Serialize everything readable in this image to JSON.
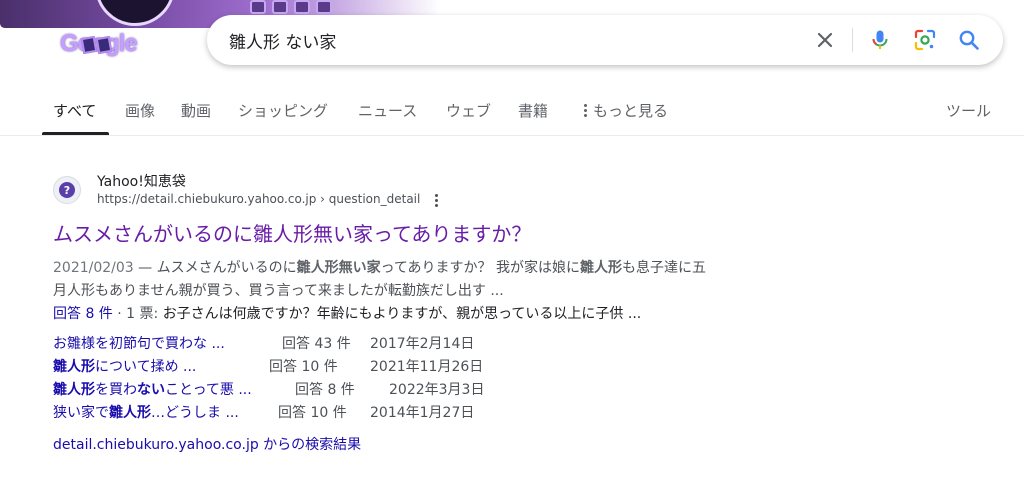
{
  "header": {
    "logo_text": "Google"
  },
  "search": {
    "query": "雛人形 ない家"
  },
  "tabs": [
    {
      "label": "すべて",
      "active": true
    },
    {
      "label": "画像"
    },
    {
      "label": "動画"
    },
    {
      "label": "ショッピング"
    },
    {
      "label": "ニュース"
    },
    {
      "label": "ウェブ"
    },
    {
      "label": "書籍"
    },
    {
      "label": "もっと見る"
    }
  ],
  "tools_label": "ツール",
  "result": {
    "site_name": "Yahoo!知恵袋",
    "url": "https://detail.chiebukuro.yahoo.co.jp › question_detail",
    "title": "ムスメさんがいるのに雛人形無い家ってありますか？",
    "snippet": {
      "date": "2021/02/03",
      "sep": " — ",
      "part1": "ムスメさんがいるのに",
      "bold1": "雛人形無い家",
      "part2": "ってありますか？ 我が家は娘に",
      "bold2": "雛人形",
      "part3": "も息子達に五",
      "line2": "月人形もありません親が買う、買う言って来ましたが転勤族だし出す ..."
    },
    "meta": {
      "answers": "回答 8 件",
      "votes": " · 1 票: ",
      "text": "お子さんは何歳ですか？年齢にもよりますが、親が思っている以上に子供 ..."
    },
    "sublinks": [
      {
        "pre": "お雛様を初節句で買わな ...",
        "bold": "",
        "post": "",
        "count": "回答 43 件",
        "date": "2017年2月14日"
      },
      {
        "pre": "",
        "bold": "雛人形",
        "post": "について揉め ...",
        "count": "回答 10 件",
        "date": "2021年11月26日"
      },
      {
        "pre": "",
        "bold": "雛人形",
        "mid": "を買わ",
        "bold2": "ない",
        "post": "ことって悪 ...",
        "count": "回答 8 件",
        "date": "2022年3月3日"
      },
      {
        "pre": "狭い家で",
        "bold": "雛人形",
        "post": "…どうしま ...",
        "count": "回答 10 件",
        "date": "2014年1月27日"
      }
    ],
    "more_results": "detail.chiebukuro.yahoo.co.jp からの検索結果"
  },
  "colors": {
    "link": "#1a0dab",
    "visited": "#681da8",
    "google_blue": "#4285f4"
  }
}
